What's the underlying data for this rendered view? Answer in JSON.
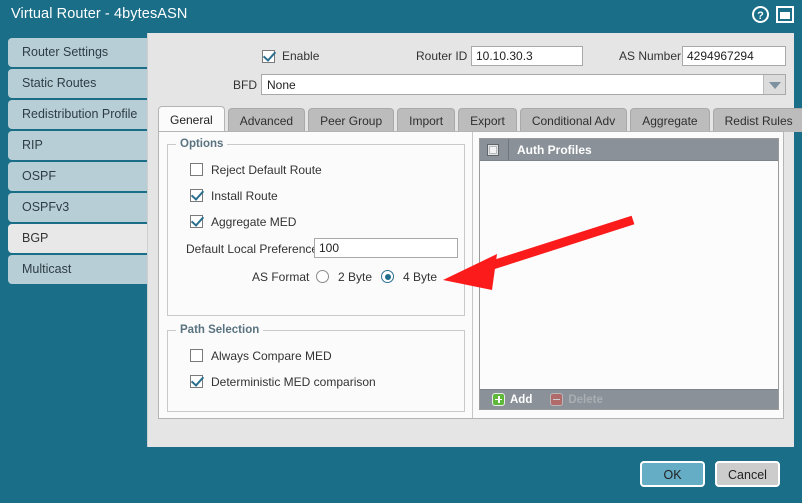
{
  "window": {
    "title": "Virtual Router - 4bytesASN",
    "help_icon": "help-circle-icon",
    "maximize_icon": "window-icon",
    "help_glyph": "?"
  },
  "sidebar": {
    "items": [
      {
        "label": "Router Settings",
        "active": false
      },
      {
        "label": "Static Routes",
        "active": false
      },
      {
        "label": "Redistribution Profile",
        "active": false
      },
      {
        "label": "RIP",
        "active": false
      },
      {
        "label": "OSPF",
        "active": false
      },
      {
        "label": "OSPFv3",
        "active": false
      },
      {
        "label": "BGP",
        "active": true
      },
      {
        "label": "Multicast",
        "active": false
      }
    ]
  },
  "form": {
    "enable_label": "Enable",
    "enable_checked": true,
    "router_id_label": "Router ID",
    "router_id_value": "10.10.30.3",
    "as_number_label": "AS Number",
    "as_number_value": "4294967294",
    "bfd_label": "BFD",
    "bfd_value": "None",
    "bfd_arrow_icon": "chevron-down-icon"
  },
  "tabs": [
    {
      "label": "General",
      "active": true
    },
    {
      "label": "Advanced",
      "active": false
    },
    {
      "label": "Peer Group",
      "active": false
    },
    {
      "label": "Import",
      "active": false
    },
    {
      "label": "Export",
      "active": false
    },
    {
      "label": "Conditional Adv",
      "active": false
    },
    {
      "label": "Aggregate",
      "active": false
    },
    {
      "label": "Redist Rules",
      "active": false
    }
  ],
  "options": {
    "legend": "Options",
    "checkboxes": [
      {
        "label": "Reject Default Route",
        "checked": false
      },
      {
        "label": "Install Route",
        "checked": true
      },
      {
        "label": "Aggregate MED",
        "checked": true
      }
    ],
    "default_local_pref_label": "Default Local Preference",
    "default_local_pref_value": "100",
    "as_format_label": "AS Format",
    "as_format_options": [
      {
        "label": "2 Byte",
        "selected": false
      },
      {
        "label": "4 Byte",
        "selected": true
      }
    ]
  },
  "path_selection": {
    "legend": "Path Selection",
    "checkboxes": [
      {
        "label": "Always Compare MED",
        "checked": false
      },
      {
        "label": "Deterministic MED comparison",
        "checked": true
      }
    ]
  },
  "auth_profiles": {
    "header_title": "Auth Profiles",
    "header_checkbox_icon": "select-all-checkbox-icon",
    "rows": [],
    "add_label": "Add",
    "add_icon": "plus-icon",
    "delete_label": "Delete",
    "delete_icon": "minus-icon",
    "delete_enabled": false
  },
  "footer": {
    "ok_label": "OK",
    "cancel_label": "Cancel"
  },
  "annotation": {
    "arrow_color": "#fb1b1b",
    "points_to": "4 Byte"
  },
  "colors": {
    "window_bg": "#1a6e88",
    "dialog_bg": "#e5e5e5",
    "nav_bg": "#b8ced6",
    "nav_active_bg": "#e8e8e8",
    "accent": "#1f6d8c",
    "table_header": "#8a9198",
    "ok_button": "#64adc4",
    "arrow_red": "#fb1b1b"
  }
}
